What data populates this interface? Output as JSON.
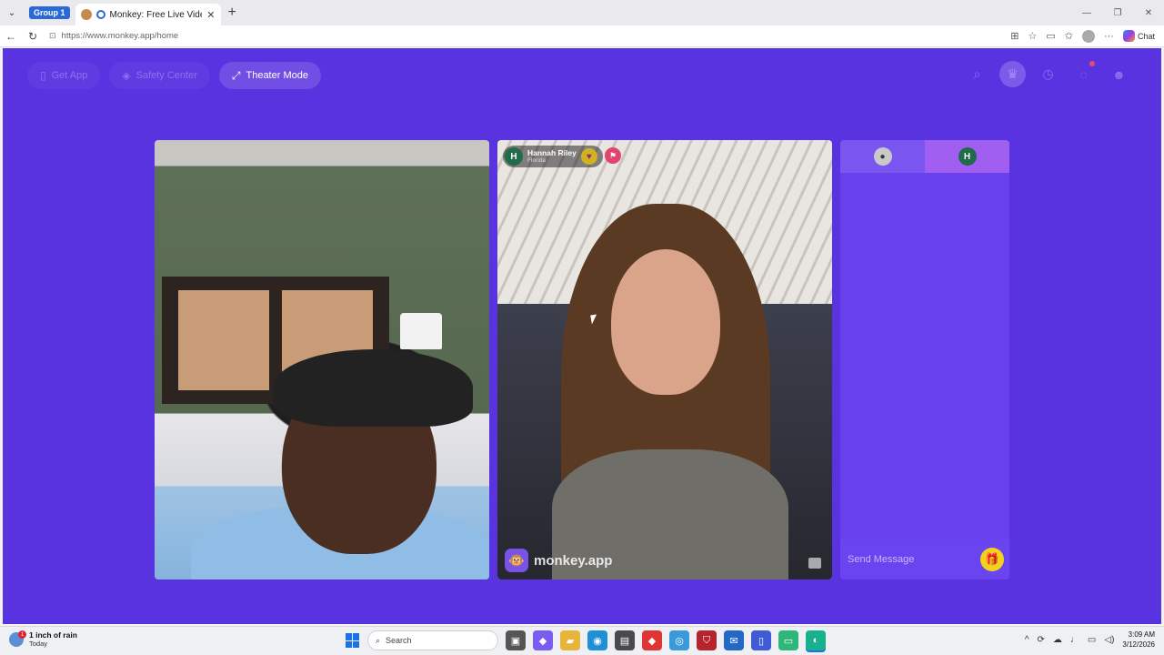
{
  "browser": {
    "group_label": "Group 1",
    "tab_title": "Monkey: Free Live Video Chat",
    "url": "https://www.monkey.app/home",
    "copilot_label": "Chat"
  },
  "nav": {
    "get_app": "Get App",
    "safety_center": "Safety Center",
    "theater_mode": "Theater Mode"
  },
  "remote_user": {
    "initial": "H",
    "name": "Hannah Riley",
    "location": "Florida"
  },
  "watermark": "monkey.app",
  "chat": {
    "tab2_initial": "H",
    "input_placeholder": "Send Message"
  },
  "taskbar": {
    "weather_badge": "1",
    "weather_main": "1 inch of rain",
    "weather_sub": "Today",
    "search_label": "Search",
    "time": "3:09 AM",
    "date": "3/12/2026"
  },
  "icons": {
    "search": "search-icon",
    "crown": "crown-icon",
    "history": "history-icon",
    "messages": "chat-bubble-icon",
    "profile": "monkey-avatar-icon",
    "gift": "gift-icon"
  },
  "colors": {
    "page_bg": "#5a33e0",
    "chat_bg": "#6840ec",
    "gift": "#f2d31c",
    "notification": "#e94a6b"
  }
}
